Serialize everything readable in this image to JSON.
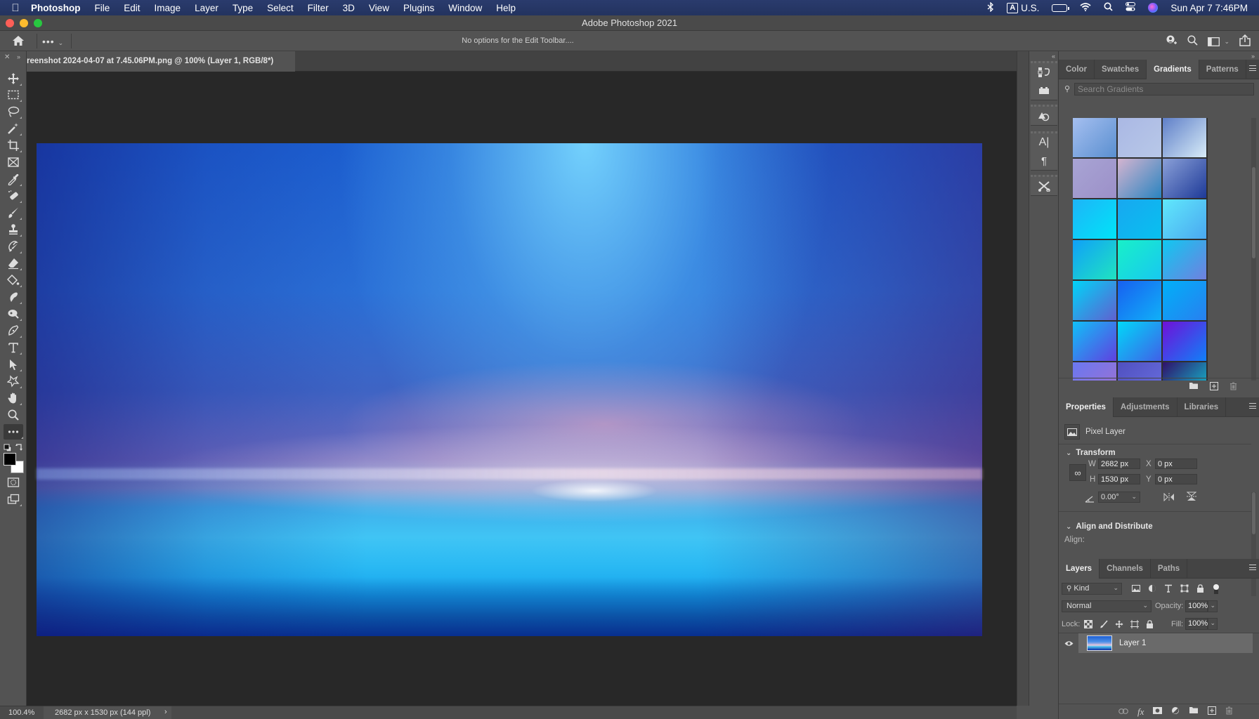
{
  "menubar": {
    "app_name": "Photoshop",
    "items": [
      "File",
      "Edit",
      "Image",
      "Layer",
      "Type",
      "Select",
      "Filter",
      "3D",
      "View",
      "Plugins",
      "Window",
      "Help"
    ],
    "input_source": "U.S.",
    "input_badge": "A",
    "datetime": "Sun Apr 7  7:46PM",
    "status_icons": [
      "bluetooth-icon",
      "keyboard-input-icon",
      "battery-charging-icon",
      "wifi-icon",
      "spotlight-search-icon",
      "control-center-icon",
      "siri-icon"
    ]
  },
  "window": {
    "title": "Adobe Photoshop 2021",
    "traffic_colors": {
      "close": "#ff5f57",
      "minimize": "#febc2e",
      "zoom": "#28c840"
    }
  },
  "options_bar": {
    "more_label": "•••",
    "message": "No options for the Edit Toolbar...."
  },
  "document": {
    "tab_title": "reenshot 2024-04-07 at 7.45.06PM.png @ 100% (Layer 1, RGB/8*)"
  },
  "tools": [
    "move-tool",
    "rectangular-marquee-tool",
    "lasso-tool",
    "magic-wand-tool",
    "crop-tool",
    "frame-tool",
    "eyedropper-tool",
    "spot-healing-brush-tool",
    "brush-tool",
    "clone-stamp-tool",
    "history-brush-tool",
    "eraser-tool",
    "paint-bucket-tool",
    "smudge-tool",
    "dodge-tool",
    "pen-tool",
    "type-tool",
    "path-selection-tool",
    "custom-shape-tool",
    "hand-tool",
    "zoom-tool",
    "edit-toolbar"
  ],
  "colors": {
    "foreground": "#000000",
    "background": "#ffffff"
  },
  "status_bar": {
    "zoom": "100.4%",
    "doc_info": "2682 px x 1530 px (144 ppl)",
    "arrow": "›"
  },
  "gradients_panel": {
    "tabs": [
      "Color",
      "Swatches",
      "Gradients",
      "Patterns"
    ],
    "active_tab": "Gradients",
    "search_placeholder": "Search Gradients",
    "swatches": [
      [
        "#a5bff0",
        "#5a8fd0"
      ],
      [
        "#aab8e4",
        "#b8c8e8"
      ],
      [
        "#5f7fc8",
        "#d8ecf8"
      ],
      [
        "#a8a4d4",
        "#9c90c8"
      ],
      [
        "#d4b4d0",
        "#2a84c0"
      ],
      [
        "#8aa0d8",
        "#1e3a98"
      ],
      [
        "#1eb4f8",
        "#00e4f8"
      ],
      [
        "#18a8f0",
        "#08c0f0"
      ],
      [
        "#60e8fc",
        "#4aa8f0"
      ],
      [
        "#10a0f8",
        "#20e4c0"
      ],
      [
        "#18f0c8",
        "#18c8f0"
      ],
      [
        "#10c8f0",
        "#7080e0"
      ],
      [
        "#00d4f8",
        "#6060d0"
      ],
      [
        "#1860f0",
        "#10b0f8"
      ],
      [
        "#00b0f8",
        "#2880f0"
      ],
      [
        "#10c0f8",
        "#6040e0"
      ],
      [
        "#00d8f8",
        "#4060e8"
      ],
      [
        "#7010d8",
        "#1080f8"
      ],
      [
        "#6a78f0",
        "#a070d0"
      ],
      [
        "#5050c0",
        "#6a70e0"
      ],
      [
        "#30106a",
        "#10d0d8"
      ]
    ],
    "footer_icons": [
      "new-group-icon",
      "new-gradient-icon",
      "delete-icon"
    ]
  },
  "properties_panel": {
    "tabs": [
      "Properties",
      "Adjustments",
      "Libraries"
    ],
    "active_tab": "Properties",
    "layer_type": "Pixel Layer",
    "transform": {
      "heading": "Transform",
      "w_label": "W",
      "w_value": "2682 px",
      "h_label": "H",
      "h_value": "1530 px",
      "x_label": "X",
      "x_value": "0 px",
      "y_label": "Y",
      "y_value": "0 px",
      "angle_value": "0.00°"
    },
    "align": {
      "heading": "Align and Distribute",
      "label": "Align:"
    }
  },
  "layers_panel": {
    "tabs": [
      "Layers",
      "Channels",
      "Paths"
    ],
    "active_tab": "Layers",
    "filter_kind": "Kind",
    "blend_mode": "Normal",
    "opacity_label": "Opacity:",
    "opacity_value": "100%",
    "lock_label": "Lock:",
    "fill_label": "Fill:",
    "fill_value": "100%",
    "layers": [
      {
        "name": "Layer 1",
        "visible": true,
        "selected": true
      }
    ],
    "footer_icons": [
      "link-layers-icon",
      "fx-icon",
      "layer-mask-icon",
      "adjustment-layer-icon",
      "new-group-icon",
      "new-layer-icon",
      "delete-icon"
    ]
  }
}
